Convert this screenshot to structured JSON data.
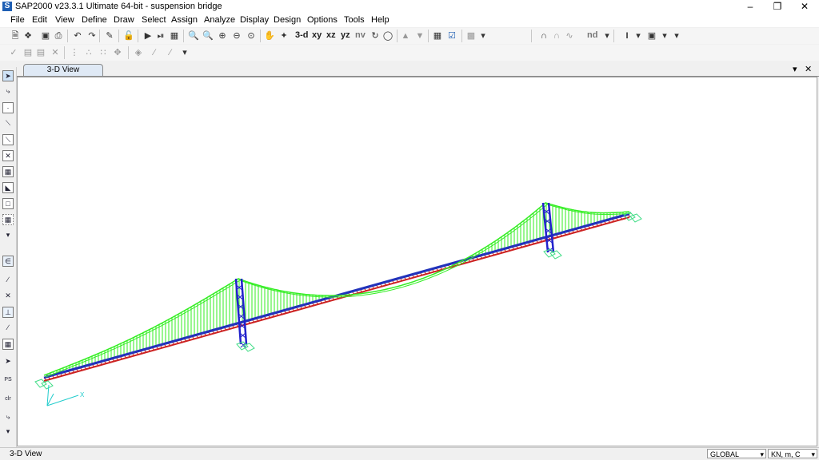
{
  "window": {
    "title": "SAP2000 v23.3.1 Ultimate 64-bit - suspension bridge",
    "app_icon_letter": "S"
  },
  "menu": [
    "File",
    "Edit",
    "View",
    "Define",
    "Draw",
    "Select",
    "Assign",
    "Analyze",
    "Display",
    "Design",
    "Options",
    "Tools",
    "Help"
  ],
  "toolbar": {
    "view_3d": "3-d",
    "view_xy": "xy",
    "view_xz": "xz",
    "view_yz": "yz",
    "view_nv": "nv",
    "label_nd": "nd"
  },
  "tab": {
    "label": "3-D View"
  },
  "status": {
    "left_text": "3-D View",
    "coord_system": "GLOBAL",
    "units": "KN, m, C"
  },
  "axes": {
    "x_label": "X"
  },
  "colors": {
    "cables": "#33ee22",
    "towers": "#2222cc",
    "deck_top": "#2233bb",
    "deck_bottom": "#cc2222",
    "supports": "#44dd88"
  }
}
